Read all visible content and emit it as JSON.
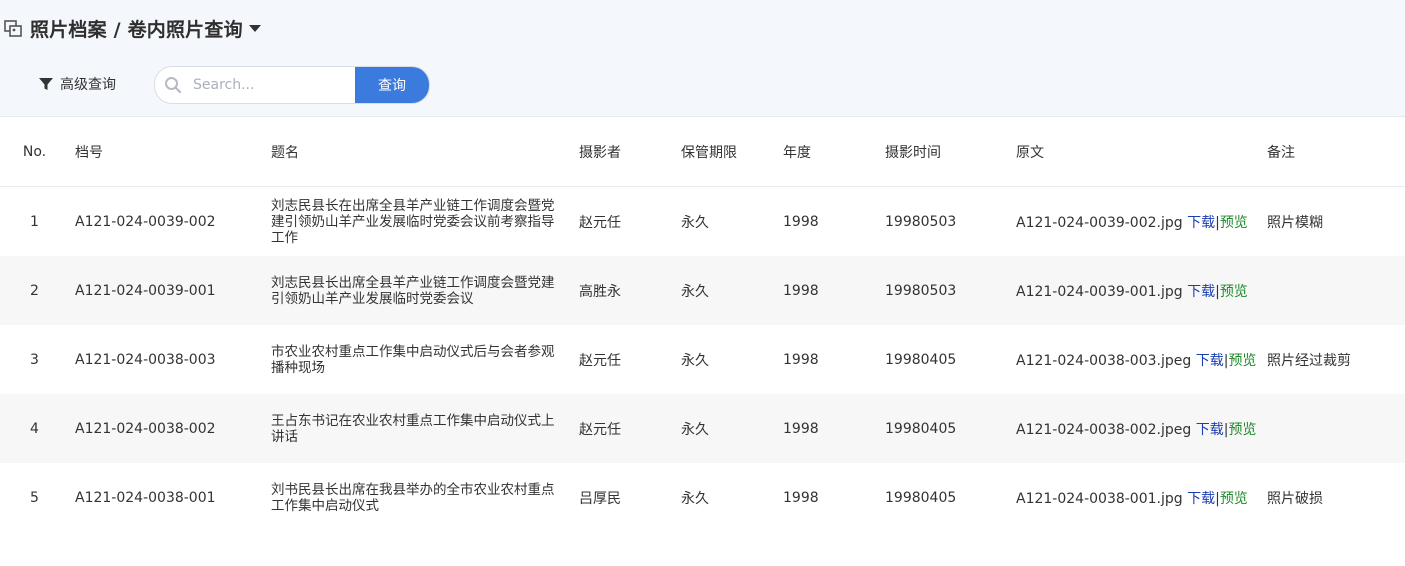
{
  "header": {
    "title": "照片档案 / 卷内照片查询",
    "advanced_search_label": "高级查询",
    "search_placeholder": "Search...",
    "search_button_label": "查询"
  },
  "table": {
    "columns": {
      "no": "No.",
      "archive_id": "档号",
      "title": "题名",
      "photographer": "摄影者",
      "retention": "保管期限",
      "year": "年度",
      "shoot_date": "摄影时间",
      "original": "原文",
      "remark": "备注"
    },
    "download_label": "下载",
    "preview_label": "预览",
    "separator": "|",
    "rows": [
      {
        "no": "1",
        "archive_id": "A121-024-0039-002",
        "title": "刘志民县长在出席全县羊产业链工作调度会暨党建引领奶山羊产业发展临时党委会议前考察指导工作",
        "photographer": "赵元任",
        "retention": "永久",
        "year": "1998",
        "shoot_date": "19980503",
        "file": "A121-024-0039-002.jpg",
        "remark": "照片模糊"
      },
      {
        "no": "2",
        "archive_id": "A121-024-0039-001",
        "title": "刘志民县长出席全县羊产业链工作调度会暨党建引领奶山羊产业发展临时党委会议",
        "photographer": "高胜永",
        "retention": "永久",
        "year": "1998",
        "shoot_date": "19980503",
        "file": "A121-024-0039-001.jpg",
        "remark": ""
      },
      {
        "no": "3",
        "archive_id": "A121-024-0038-003",
        "title": "市农业农村重点工作集中启动仪式后与会者参观播种现场",
        "photographer": "赵元任",
        "retention": "永久",
        "year": "1998",
        "shoot_date": "19980405",
        "file": "A121-024-0038-003.jpeg",
        "remark": "照片经过裁剪"
      },
      {
        "no": "4",
        "archive_id": "A121-024-0038-002",
        "title": "王占东书记在农业农村重点工作集中启动仪式上讲话",
        "photographer": "赵元任",
        "retention": "永久",
        "year": "1998",
        "shoot_date": "19980405",
        "file": "A121-024-0038-002.jpeg",
        "remark": ""
      },
      {
        "no": "5",
        "archive_id": "A121-024-0038-001",
        "title": "刘书民县长出席在我县举办的全市农业农村重点工作集中启动仪式",
        "photographer": "吕厚民",
        "retention": "永久",
        "year": "1998",
        "shoot_date": "19980405",
        "file": "A121-024-0038-001.jpg",
        "remark": "照片破损"
      }
    ]
  }
}
